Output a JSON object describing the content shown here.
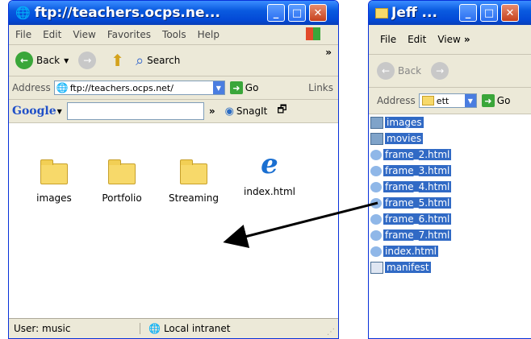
{
  "win1": {
    "title": "ftp://teachers.ocps.ne...",
    "menu": [
      "File",
      "Edit",
      "View",
      "Favorites",
      "Tools",
      "Help"
    ],
    "back_label": "Back",
    "search_label": "Search",
    "address_label": "Address",
    "address_value": "ftp://teachers.ocps.net/",
    "go_label": "Go",
    "links_label": "Links",
    "google_label": "Google",
    "snagit_label": "SnagIt",
    "items": [
      {
        "label": "images",
        "icon": "folder-icon"
      },
      {
        "label": "Portfolio",
        "icon": "folder-icon"
      },
      {
        "label": "Streaming",
        "icon": "folder-icon"
      },
      {
        "label": "index.html",
        "icon": "ie-document-icon"
      }
    ],
    "status_user": "User: music",
    "status_zone": "Local intranet"
  },
  "win2": {
    "title": "Jeff ...",
    "menu": [
      "File",
      "Edit",
      "View"
    ],
    "back_label": "Back",
    "address_label": "Address",
    "address_value": "ett",
    "go_label": "Go",
    "files": [
      {
        "label": "images",
        "icon": "folder-icon"
      },
      {
        "label": "movies",
        "icon": "folder-icon"
      },
      {
        "label": "frame_2.html",
        "icon": "ie-document-icon"
      },
      {
        "label": "frame_3.html",
        "icon": "ie-document-icon"
      },
      {
        "label": "frame_4.html",
        "icon": "ie-document-icon"
      },
      {
        "label": "frame_5.html",
        "icon": "ie-document-icon"
      },
      {
        "label": "frame_6.html",
        "icon": "ie-document-icon"
      },
      {
        "label": "frame_7.html",
        "icon": "ie-document-icon"
      },
      {
        "label": "index.html",
        "icon": "ie-document-icon"
      },
      {
        "label": "manifest",
        "icon": "xml-file-icon"
      }
    ]
  },
  "colors": {
    "selection": "#316ac5",
    "titlebar": "#0a5be0"
  }
}
